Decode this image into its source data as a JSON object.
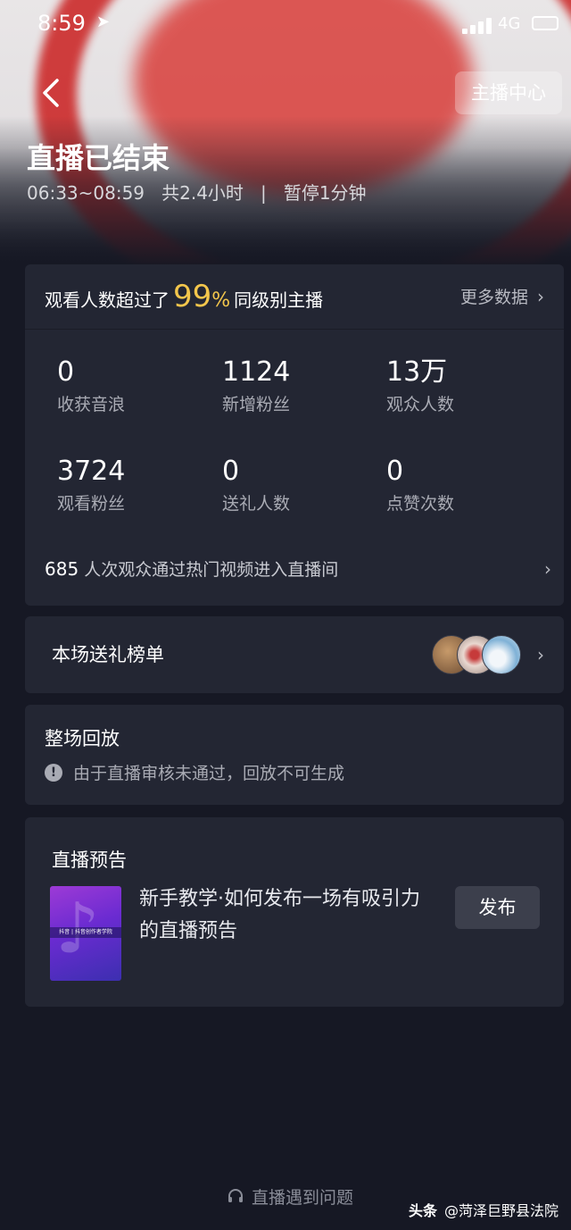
{
  "status_bar": {
    "time": "8:59",
    "network": "4G"
  },
  "nav": {
    "anchor_center": "主播中心"
  },
  "header": {
    "title": "直播已结束",
    "time_range": "06:33~08:59",
    "duration": "共2.4小时",
    "separator": "|",
    "pause": "暂停1分钟"
  },
  "stats": {
    "exceed_prefix": "观看人数超过了",
    "exceed_percent": "99",
    "exceed_unit": "%",
    "exceed_suffix": "同级别主播",
    "more_data": "更多数据",
    "items": [
      {
        "value": "0",
        "label": "收获音浪"
      },
      {
        "value": "1124",
        "label": "新增粉丝"
      },
      {
        "value": "13万",
        "label": "观众人数"
      },
      {
        "value": "3724",
        "label": "观看粉丝"
      },
      {
        "value": "0",
        "label": "送礼人数"
      },
      {
        "value": "0",
        "label": "点赞次数"
      }
    ],
    "hot_video_count": "685",
    "hot_video_text": "人次观众通过热门视频进入直播间"
  },
  "gift_list": {
    "title": "本场送礼榜单"
  },
  "replay": {
    "title": "整场回放",
    "notice": "由于直播审核未通过，回放不可生成"
  },
  "preview": {
    "title": "直播预告",
    "thumb_caption": "抖音 | 抖音创作者学院",
    "text": "新手教学·如何发布一场有吸引力的直播预告",
    "publish": "发布"
  },
  "help": {
    "label": "直播遇到问题"
  },
  "watermark": {
    "brand": "头条",
    "account": "@菏泽巨野县法院"
  },
  "colors": {
    "background": "#161824",
    "card": "#232633",
    "highlight": "#f3c64c",
    "muted": "#a9abb4"
  }
}
